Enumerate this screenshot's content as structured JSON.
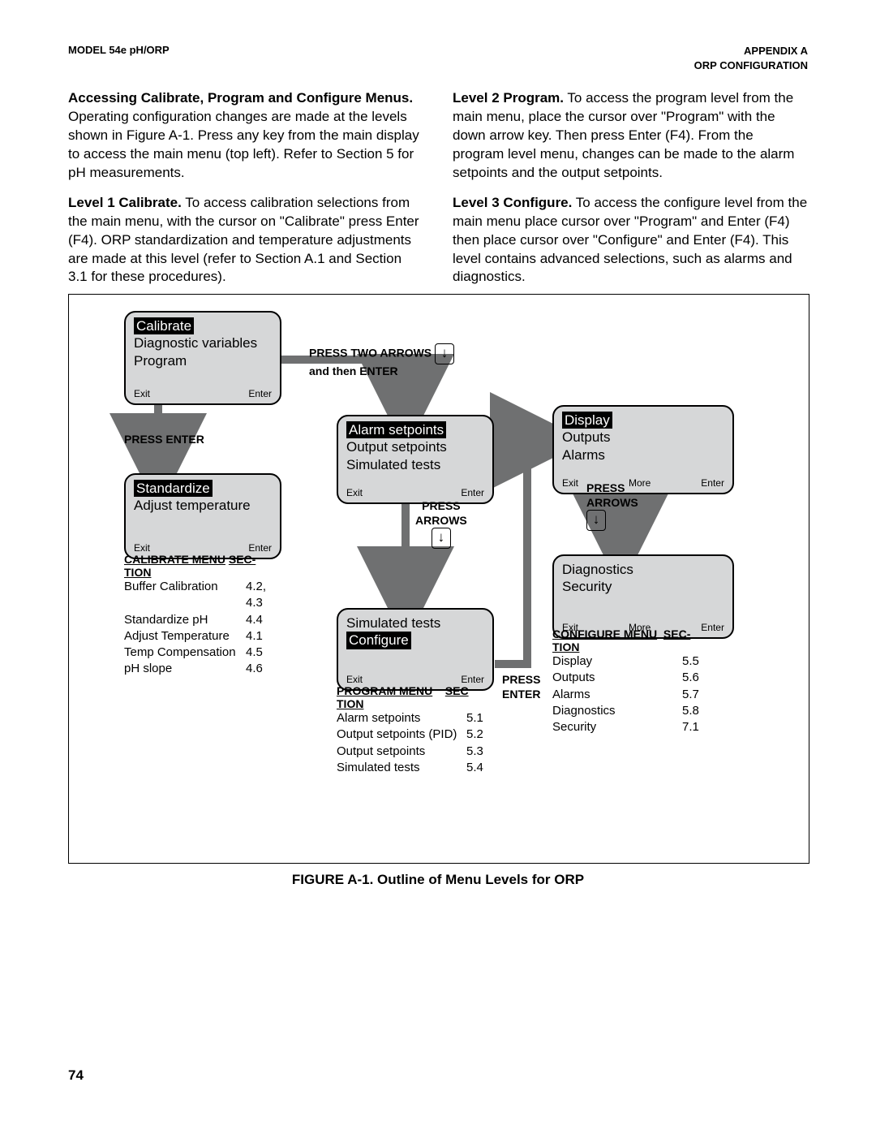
{
  "header": {
    "left": "MODEL 54e pH/ORP",
    "right1": "APPENDIX A",
    "right2": "ORP CONFIGURATION"
  },
  "left_col": {
    "p1_b": "Accessing Calibrate, Program and Configure Menus.",
    "p1": " Operating configuration changes are made at the levels shown in Figure A-1. Press any key from the main display to access the main menu (top left). Refer to Section 5 for pH measurements.",
    "p2_b": "Level 1 Calibrate.",
    "p2": " To access calibration selections from the main menu, with the cursor on \"Calibrate\" press Enter (F4). ORP standardization and temperature adjustments are made at this level (refer to Section A.1 and Section 3.1 for these procedures)."
  },
  "right_col": {
    "p1_b": "Level 2 Program.",
    "p1": " To access the program level from the main menu, place the cursor over \"Program\" with the down arrow key. Then press Enter (F4). From the program level menu, changes can be made to the alarm setpoints and the output setpoints.",
    "p2_b": "Level 3 Configure.",
    "p2": " To access the configure level from the main menu place cursor over \"Program\" and Enter (F4) then place cursor over \"Configure\" and Enter (F4). This level contains advanced selections, such as alarms and diagnostics."
  },
  "screens": {
    "main": {
      "sel": "Calibrate",
      "l2": "Diagnostic variables",
      "l3": "Program",
      "fL": "Exit",
      "fR": "Enter"
    },
    "cal": {
      "sel": "Standardize",
      "l2": "Adjust temperature",
      "fL": "Exit",
      "fR": "Enter"
    },
    "prog": {
      "sel": "Alarm setpoints",
      "l2": "Output setpoints",
      "l3": "Simulated tests",
      "fL": "Exit",
      "fR": "Enter"
    },
    "sim": {
      "l1": "Simulated tests",
      "sel": "Configure",
      "fL": "Exit",
      "fR": "Enter"
    },
    "disp": {
      "sel": "Display",
      "l2": "Outputs",
      "l3": "Alarms",
      "fL": "Exit",
      "fM": "More",
      "fR": "Enter"
    },
    "diag": {
      "l1": "Diagnostics",
      "l2": "Security",
      "fL": "Exit",
      "fM": "More",
      "fR": "Enter"
    }
  },
  "labels": {
    "press_enter": "PRESS ENTER",
    "press_two_arrows": "PRESS TWO ARROWS",
    "and_then_enter": "and then ENTER",
    "press_arrows": "PRESS",
    "press_arrows2": "ARROWS",
    "press_enter2a": "PRESS",
    "press_enter2b": "ENTER"
  },
  "cal_menu": {
    "title1": "CALIBRATE MENU",
    "title2": "SEC-",
    "title3": "TION",
    "rows": [
      {
        "c1": "Buffer Calibration",
        "c2": "4.2, 4.3"
      },
      {
        "c1": "Standardize pH",
        "c2": "4.4"
      },
      {
        "c1": "Adjust Temperature",
        "c2": "4.1"
      },
      {
        "c1": "Temp Compensation",
        "c2": "4.5"
      },
      {
        "c1": "pH slope",
        "c2": "4.6"
      }
    ]
  },
  "prog_menu": {
    "title1": "PROGRAM MENU",
    "title2": "SEC",
    "title3": "TION",
    "rows": [
      {
        "c1": "Alarm setpoints",
        "c2": "5.1"
      },
      {
        "c1": "Output setpoints (PID)",
        "c2": "5.2"
      },
      {
        "c1": "Output setpoints",
        "c2": "5.3"
      },
      {
        "c1": "Simulated tests",
        "c2": "5.4"
      }
    ]
  },
  "conf_menu": {
    "title1": "CONFIGURE MENU",
    "title2": "SEC-",
    "title3": "TION",
    "rows": [
      {
        "c1": "Display",
        "c2": "5.5"
      },
      {
        "c1": "Outputs",
        "c2": "5.6"
      },
      {
        "c1": "Alarms",
        "c2": "5.7"
      },
      {
        "c1": "Diagnostics",
        "c2": "5.8"
      },
      {
        "c1": "Security",
        "c2": "7.1"
      }
    ]
  },
  "caption": "FIGURE A-1. Outline of Menu Levels for ORP",
  "pagenum": "74",
  "arrow_glyph": "↓"
}
